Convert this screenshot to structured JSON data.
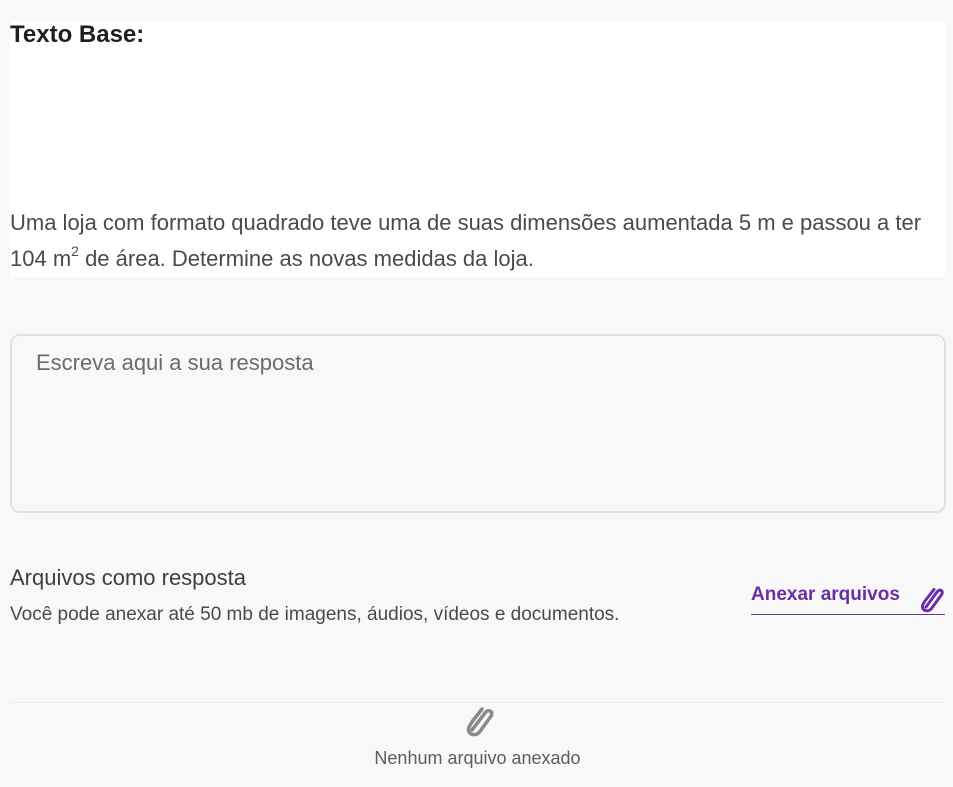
{
  "base": {
    "title": "Texto Base:",
    "text_part1": "Uma loja com formato quadrado teve uma de suas dimensões aumentada 5 m e passou a ter 104 m",
    "superscript": "2",
    "text_part2": " de área. Determine as novas medidas da loja."
  },
  "answer": {
    "placeholder": "Escreva aqui a sua resposta"
  },
  "files": {
    "title": "Arquivos como resposta",
    "description": "Você pode anexar até 50 mb de imagens, áudios, vídeos e documentos.",
    "attach_label": "Anexar arquivos",
    "attach_icon": "paperclip-icon",
    "empty_icon": "paperclip-icon",
    "empty_text": "Nenhum arquivo anexado"
  },
  "colors": {
    "accent": "#6a2fa3",
    "icon_gray": "#8a8a8e",
    "text": "#4a4a4e",
    "border": "#e1e1e1"
  }
}
